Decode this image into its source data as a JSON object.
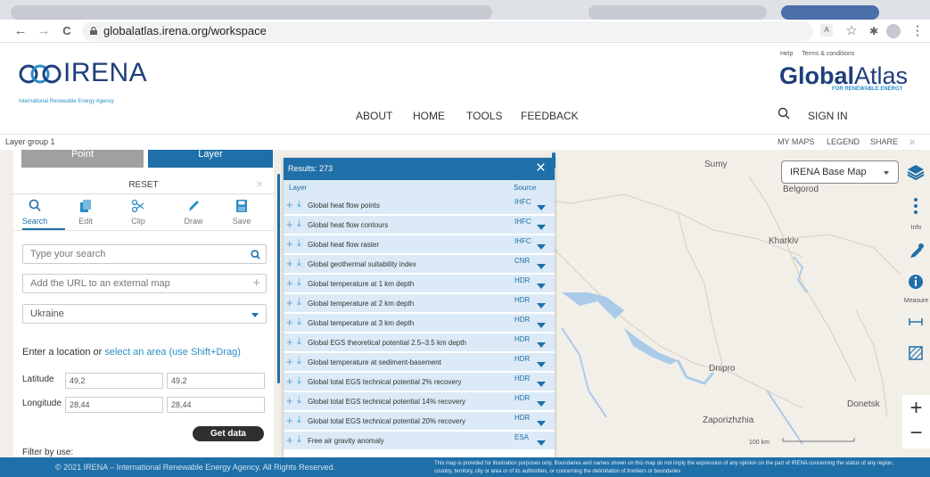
{
  "browser": {
    "url": "globalatlas.irena.org/workspace",
    "back_icon": "arrow-left-icon",
    "forward_icon": "arrow-right-icon",
    "reload_icon": "reload-icon",
    "back": "←",
    "forward": "→",
    "reload": "C",
    "menu": "⋮",
    "star": "☆",
    "puzzle": "✱"
  },
  "header": {
    "irena_brand": "IRENA",
    "irena_subtitle": "International Renewable Energy Agency",
    "help": "Help",
    "terms": "Terms & conditions",
    "global_atlas_bold": "Global",
    "global_atlas_rest": "Atlas",
    "global_atlas_sub": "FOR RENEWABLE ENERGY",
    "nav": [
      "ABOUT",
      "HOME",
      "TOOLS",
      "FEEDBACK"
    ],
    "sign_in": "SIGN IN"
  },
  "layer_group": {
    "title": "Layer group 1",
    "links": [
      "MY MAPS",
      "LEGEND",
      "SHARE"
    ],
    "close": "×"
  },
  "left_panel": {
    "toggle_point": "Point",
    "toggle_layer": "Layer",
    "reset": "RESET",
    "close": "×",
    "tools": [
      "Search",
      "Edit",
      "Clip",
      "Draw",
      "Save"
    ],
    "search_placeholder": "Type your search",
    "url_placeholder": "Add the URL to an external map",
    "plus": "+",
    "country": "Ukraine",
    "location_text": "Enter a location or",
    "location_link": "select an area (use Shift+Drag)",
    "latitude_label": "Latitude",
    "longitude_label": "Longitude",
    "lat_from": "49,2",
    "lat_to": "49,2",
    "lon_from": "28,44",
    "lon_to": "28,44",
    "get_data": "Get data",
    "filter_by_use": "Filter by use:"
  },
  "results": {
    "title": "Results: 273",
    "close": "×",
    "col_layer": "Layer",
    "col_source": "Source",
    "plus": "+",
    "download": "⤓",
    "rows": [
      {
        "name": "Global heat flow points",
        "source": "IHFC"
      },
      {
        "name": "Global heat flow contours",
        "source": "IHFC"
      },
      {
        "name": "Global heat flow raster",
        "source": "IHFC"
      },
      {
        "name": "Global geothermal suitability index",
        "source": "CNR"
      },
      {
        "name": "Global temperature at 1 km depth",
        "source": "HDR"
      },
      {
        "name": "Global temperature at 2 km depth",
        "source": "HDR"
      },
      {
        "name": "Global temperature at 3 km depth",
        "source": "HDR"
      },
      {
        "name": "Global EGS theoretical potential 2.5–3.5 km depth",
        "source": "HDR"
      },
      {
        "name": "Global temperature at sediment-basement",
        "source": "HDR"
      },
      {
        "name": "Global total EGS technical potential 2% recovery",
        "source": "HDR"
      },
      {
        "name": "Global total EGS technical potential 14% recovery",
        "source": "HDR"
      },
      {
        "name": "Global total EGS technical potential 20% recovery",
        "source": "HDR"
      },
      {
        "name": "Free air gravity anomaly",
        "source": "ESA"
      }
    ]
  },
  "map": {
    "basemap": "IRENA Base Map",
    "info_label": "Info",
    "measure_label": "Measure",
    "zoom_in": "+",
    "zoom_out": "−",
    "scale": "100 km",
    "cities": [
      "Sumy",
      "Belgorod",
      "Kharkiv",
      "Dnipro",
      "Donetsk",
      "Zaporizhzhia"
    ]
  },
  "footer": {
    "copyright": "© 2021 IRENA – International Renewable Energy Agency. All Rights Reserved.",
    "disclaimer": "This map is provided for illustration purposes only. Boundaries and names shown on this map do not imply the expression of any opinion on the part of IRENA concerning the status of any region, country, territory, city or area or of its authorities, or concerning the delimitation of frontiers or boundaries"
  },
  "colors": {
    "brand_blue": "#1f6fa8",
    "irena_navy": "#1e3f7a",
    "map_bg": "#f2efe9",
    "water": "#aacbe8"
  }
}
